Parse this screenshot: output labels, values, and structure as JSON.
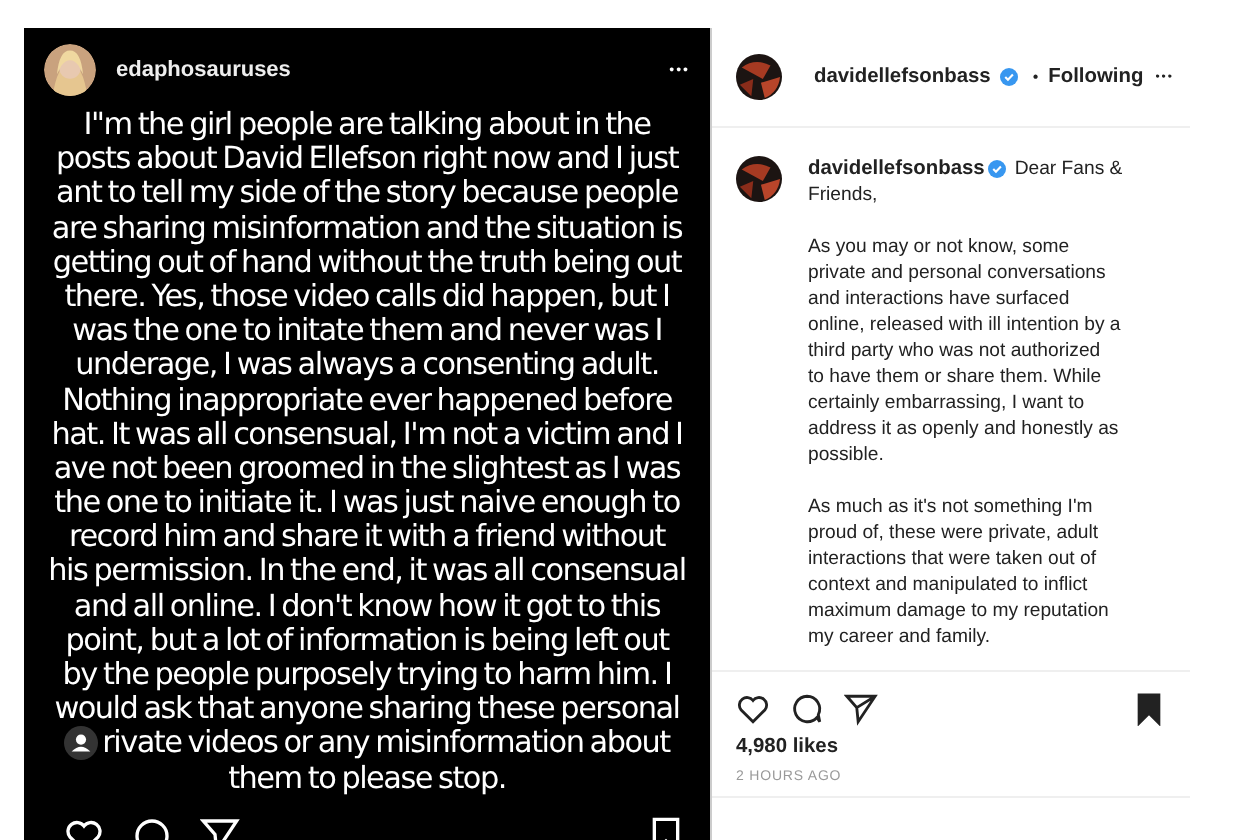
{
  "story_post": {
    "username": "edaphosauruses",
    "more": "•••",
    "lines": [
      {
        "text": "I\"m the girl people are talking about in the",
        "tagged": false
      },
      {
        "text": "posts about David Ellefson right now and I just",
        "tagged": false
      },
      {
        "text": "ant to tell my side of the story because people",
        "tagged": false
      },
      {
        "text": "are sharing misinformation and the situation is",
        "tagged": false
      },
      {
        "text": "getting out of hand without the truth being out",
        "tagged": false
      },
      {
        "text": "there. Yes, those video calls did happen, but I",
        "tagged": false
      },
      {
        "text": "was the one to initate them and never was I",
        "tagged": false
      },
      {
        "text": "underage, I was always a consenting adult.",
        "tagged": false
      },
      {
        "text": "Nothing inappropriate ever happened before",
        "tagged": false
      },
      {
        "text": "hat. It was all consensual, I'm not a victim and I",
        "tagged": false
      },
      {
        "text": "ave not been groomed in the slightest as I was",
        "tagged": false
      },
      {
        "text": "the one to initiate it. I was just naive enough to",
        "tagged": false
      },
      {
        "text": "record him and share it with a friend without",
        "tagged": false
      },
      {
        "text": "his permission. In the end, it was all consensual",
        "tagged": false
      },
      {
        "text": "and all online. I don't know how it got to this",
        "tagged": false
      },
      {
        "text": "point, but a lot of information is being left out",
        "tagged": false
      },
      {
        "text": "by the people purposely trying to harm him. I",
        "tagged": false
      },
      {
        "text": "would ask that anyone sharing these personal",
        "tagged": false
      },
      {
        "text": "rivate videos or any misinformation about",
        "tagged": true
      },
      {
        "text": "them to please stop.",
        "tagged": false
      }
    ]
  },
  "post": {
    "header_username": "davidellefsonbass",
    "verified": true,
    "separator": "•",
    "follow_status": "Following",
    "more": "•••",
    "caption_username": "davidellefsonbass",
    "caption_first_line": "Dear Fans &",
    "caption": "Friends,\n\nAs you may or not know, some\nprivate and personal conversations\nand interactions have surfaced\nonline, released with ill intention by a\nthird party who was not authorized\nto have them or share them. While\ncertainly embarrassing, I want to\naddress it as openly and honestly as\npossible.\n\nAs much as it's not something I'm\nproud of, these were private, adult\ninteractions that were taken out of\ncontext and manipulated to inflict\nmaximum damage to my reputation\nmy career and family.",
    "saved": true,
    "likes": "4,980 likes",
    "time": "2 HOURS AGO"
  }
}
